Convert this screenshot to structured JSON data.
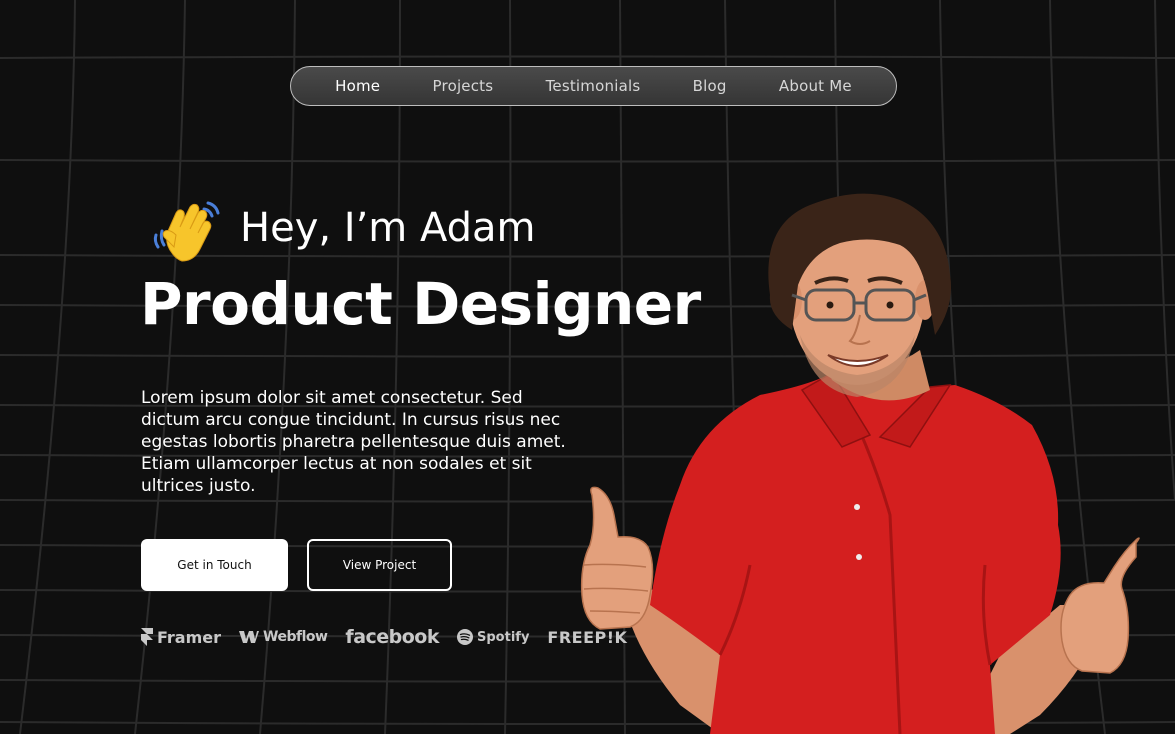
{
  "nav": {
    "items": [
      {
        "label": "Home",
        "active": true
      },
      {
        "label": "Projects"
      },
      {
        "label": "Testimonials"
      },
      {
        "label": "Blog"
      },
      {
        "label": "About Me"
      }
    ]
  },
  "hero": {
    "greeting": "Hey, I’m Adam",
    "title": "Product Designer",
    "description": "Lorem ipsum dolor sit amet consectetur. Sed dictum arcu congue tincidunt. In cursus risus nec egestas lobortis pharetra pellentesque duis amet. Etiam ullamcorper lectus at non sodales et sit ultrices justo.",
    "primary_button": "Get in Touch",
    "secondary_button": "View Project",
    "wave_icon": "waving-hand-emoji"
  },
  "logos": [
    {
      "name": "Framer",
      "icon": "framer-icon"
    },
    {
      "name": "Webflow",
      "icon": "webflow-icon"
    },
    {
      "name": "facebook"
    },
    {
      "name": "Spotify",
      "icon": "spotify-icon"
    },
    {
      "name": "FREEP!K"
    }
  ],
  "colors": {
    "background": "#0f0f0f",
    "grid": "#2a2a2a",
    "shirt": "#d41f1f",
    "skin": "#e3a07c",
    "hair": "#3a2418"
  }
}
